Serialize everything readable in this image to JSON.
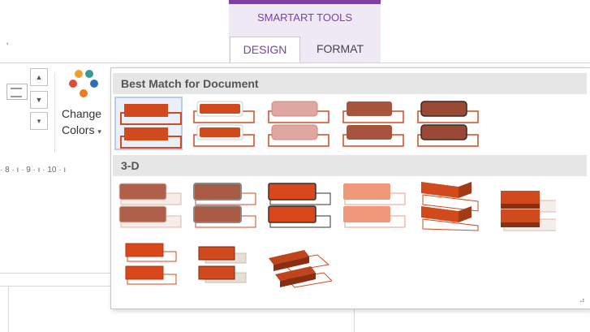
{
  "ribbon": {
    "context_title": "SMARTART TOOLS",
    "tabs": [
      {
        "label": "DESIGN",
        "active": true
      },
      {
        "label": "FORMAT",
        "active": false
      }
    ],
    "change_colors": {
      "line1": "Change",
      "line2": "Colors",
      "arrow": "▾"
    },
    "spin_up": "▲",
    "spin_down": "▼",
    "spin_more": "▾",
    "left_glyph": "'"
  },
  "ruler": {
    "text": "· 8 · ı · 9 · ı · 10 · ı"
  },
  "gallery": {
    "sections": [
      {
        "title": "Best Match for Document"
      },
      {
        "title": "3-D"
      }
    ],
    "selected_index": 0,
    "resize_grip": "⠴"
  },
  "colors": {
    "accent": "#d04a1e",
    "context_purple": "#7b3fa6",
    "dots": [
      "#f0a030",
      "#3a9a8f",
      "#e04a3a",
      "#2f6fb5",
      "#f07a20"
    ]
  }
}
